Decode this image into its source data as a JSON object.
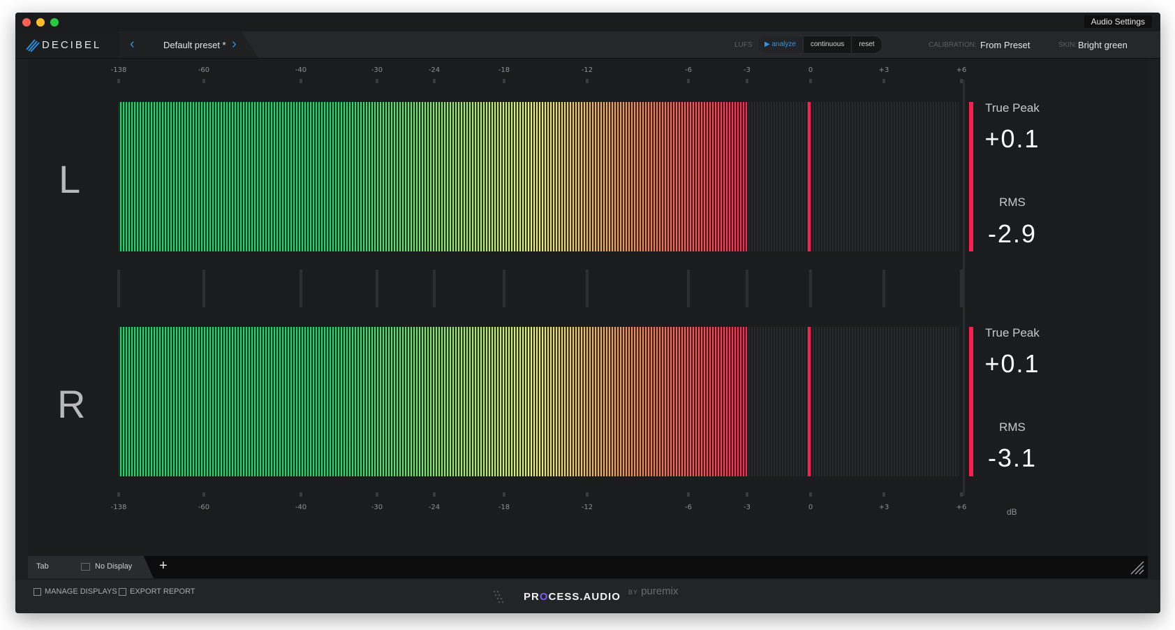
{
  "window": {
    "audio_settings": "Audio Settings"
  },
  "header": {
    "logo": "DECIBEL",
    "preset": "Default preset *",
    "lufs_label": "LUFS",
    "lufs_buttons": [
      {
        "label": "▶ analyze",
        "active": true
      },
      {
        "label": "continuous",
        "active": false
      },
      {
        "label": "reset",
        "active": false
      }
    ],
    "calibration_label": "CALIBRATION:",
    "calibration_value": "From Preset",
    "skin_label": "SKIN:",
    "skin_value": "Bright green"
  },
  "meter": {
    "scale_labels": [
      "-138",
      "-60",
      "-40",
      "-30",
      "-24",
      "-18",
      "-12",
      "-6",
      "-3",
      "0",
      "+3",
      "+6"
    ],
    "unit_label": "dB",
    "colors": {
      "green": "#22d66a",
      "yellow": "#e6f07a",
      "red": "#ff2a4e",
      "peak_marker": "#ff1f4f"
    },
    "channels": [
      {
        "id": "L",
        "label": "L",
        "level_db": -3.0,
        "peak_db": 0,
        "true_peak_label": "True Peak",
        "true_peak": "+0.1",
        "rms_label": "RMS",
        "rms": "-2.9"
      },
      {
        "id": "R",
        "label": "R",
        "level_db": -3.0,
        "peak_db": 0,
        "true_peak_label": "True Peak",
        "true_peak": "+0.1",
        "rms_label": "RMS",
        "rms": "-3.1"
      }
    ]
  },
  "tabs": [
    {
      "name": "Tab",
      "display": "No Display"
    }
  ],
  "footer": {
    "manage": "MANAGE DISPLAYS",
    "export": "EXPORT REPORT",
    "brand_prefix": "PR",
    "brand_o": "O",
    "brand_suffix": "CESS.AUDIO",
    "by": "BY",
    "partner": "puremix"
  }
}
